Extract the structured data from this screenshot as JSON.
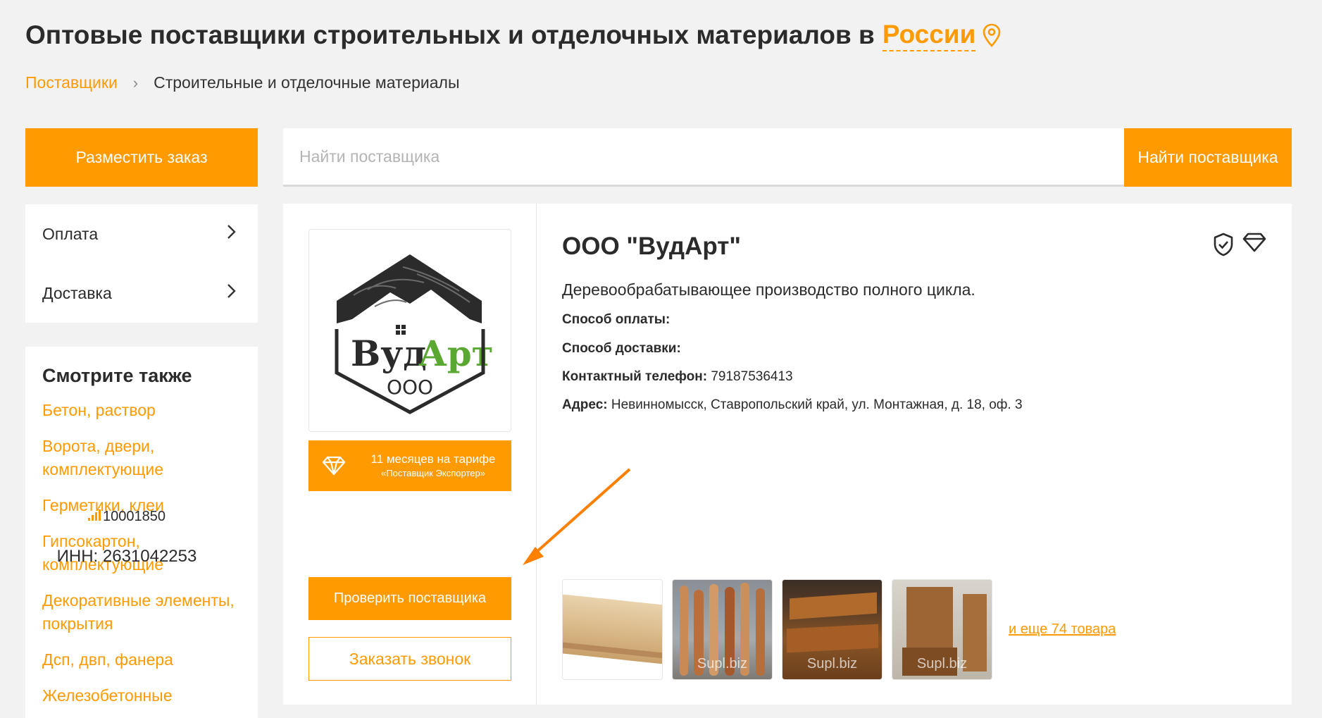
{
  "header": {
    "title": "Оптовые поставщики строительных и отделочных материалов в",
    "region": "России"
  },
  "breadcrumb": {
    "root": "Поставщики",
    "separator": "›",
    "current": "Строительные и отделочные материалы"
  },
  "sidebar": {
    "place_order_label": "Разместить заказ",
    "filters": [
      {
        "label": "Оплата"
      },
      {
        "label": "Доставка"
      }
    ],
    "see_also_title": "Смотрите также",
    "see_also": [
      "Бетон, раствор",
      "Ворота, двери, комплектующие",
      "Герметики, клеи",
      "Гипсокартон, комплектующие",
      "Декоративные элементы, покрытия",
      "Дсп, двп, фанера",
      "Железобетонные"
    ]
  },
  "search": {
    "placeholder": "Найти поставщика",
    "button_label": "Найти поставщика"
  },
  "supplier": {
    "logo_text": "ВудАрт",
    "logo_sub": "ООО",
    "tariff_line1": "11 месяцев на тарифе",
    "tariff_line2": "«Поставщик Экспортер»",
    "rating": "10001850",
    "inn": "ИНН: 2631042253",
    "check_button": "Проверить поставщика",
    "call_button": "Заказать звонок",
    "name": "ООО \"ВудАрт\"",
    "description": "Деревообрабатывающее производство полного цикла.",
    "payment_label": "Способ оплаты:",
    "payment_value": "",
    "delivery_label": "Способ доставки:",
    "delivery_value": "",
    "phone_label": "Контактный телефон:",
    "phone_value": "79187536413",
    "address_label": "Адрес:",
    "address_value": "Невинномысск, Ставропольский край, ул. Монтажная, д. 18, оф. 3",
    "thumb_watermark": "Supl.biz",
    "more_products": "и еще 74 товара"
  },
  "colors": {
    "accent": "#ff9a00",
    "background": "#f2f2f2",
    "text": "#2b2b2b"
  }
}
